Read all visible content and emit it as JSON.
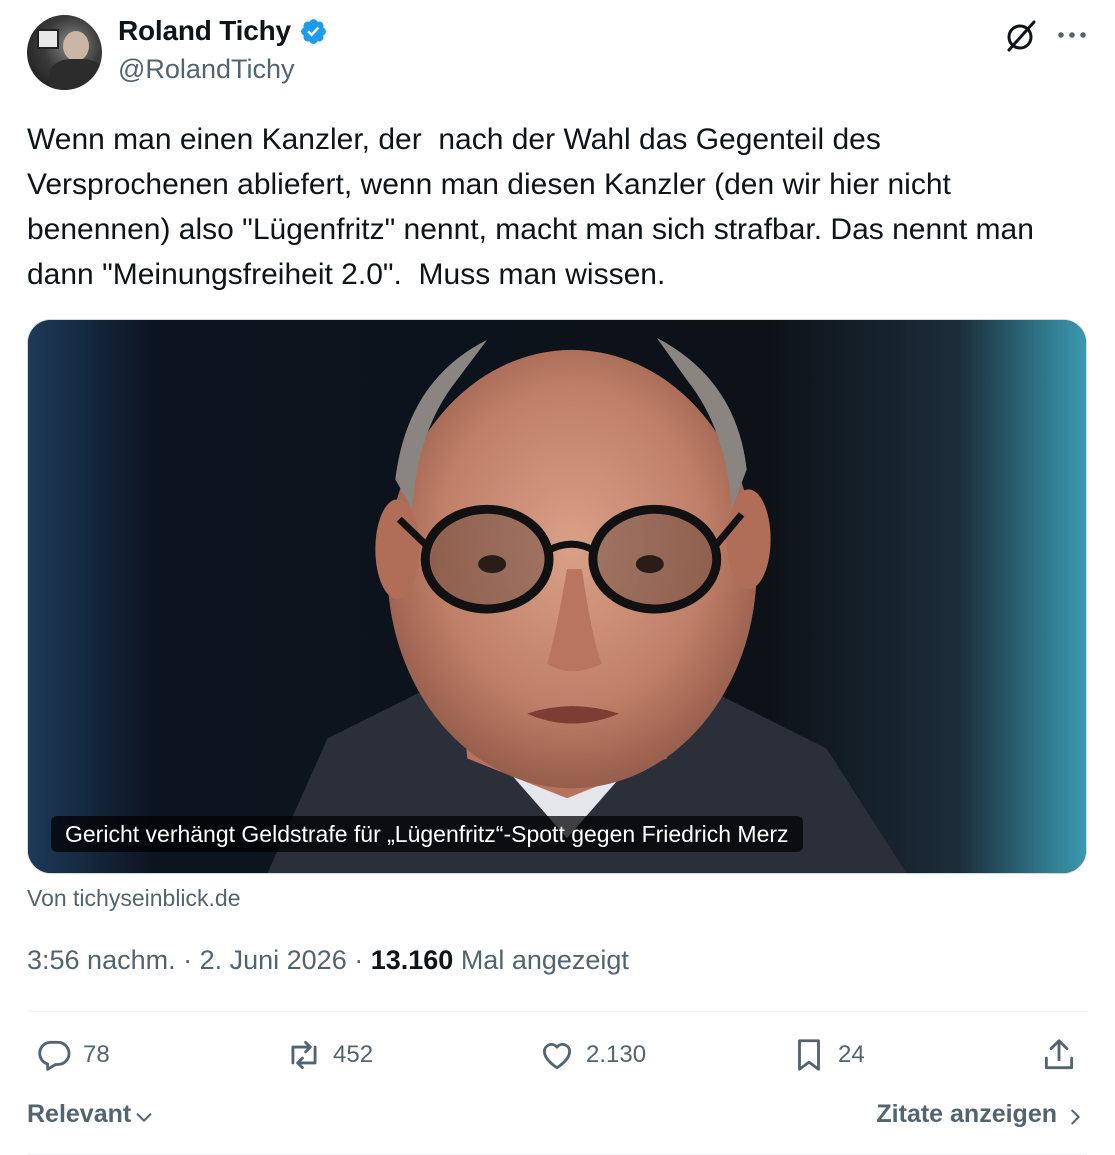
{
  "author": {
    "display_name": "Roland Tichy",
    "handle": "@RolandTichy",
    "verified": true
  },
  "colors": {
    "text": "#0f1419",
    "secondary": "#536471",
    "verified_badge": "#1d9bf0",
    "divider": "#eff3f4"
  },
  "icons": {
    "grok": "grok-icon",
    "more": "more-dots-icon",
    "reply": "reply-bubble-icon",
    "retweet": "retweet-icon",
    "like": "heart-icon",
    "bookmark": "bookmark-icon",
    "share": "share-icon"
  },
  "tweet": {
    "text": "Wenn man einen Kanzler, der  nach der Wahl das Gegenteil des Versprochenen abliefert, wenn man diesen Kanzler (den wir hier nicht benennen) also \"Lügenfritz\" nennt, macht man sich strafbar. Das nennt man dann \"Meinungsfreiheit 2.0\".  Muss man wissen."
  },
  "card": {
    "caption": "Gericht verhängt Geldstrafe für „Lügenfritz“-Spott gegen Friedrich Merz",
    "source": "Von tichyseinblick.de"
  },
  "meta": {
    "time": "3:56 nachm.",
    "separator": " · ",
    "date": "2. Juni 2026",
    "views_count": "13.160",
    "views_label": " Mal angezeigt"
  },
  "actions": {
    "replies": "78",
    "reposts": "452",
    "likes": "2.130",
    "bookmarks": "24"
  },
  "footer": {
    "sort_label": "Relevant",
    "quotes_label": "Zitate anzeigen"
  }
}
